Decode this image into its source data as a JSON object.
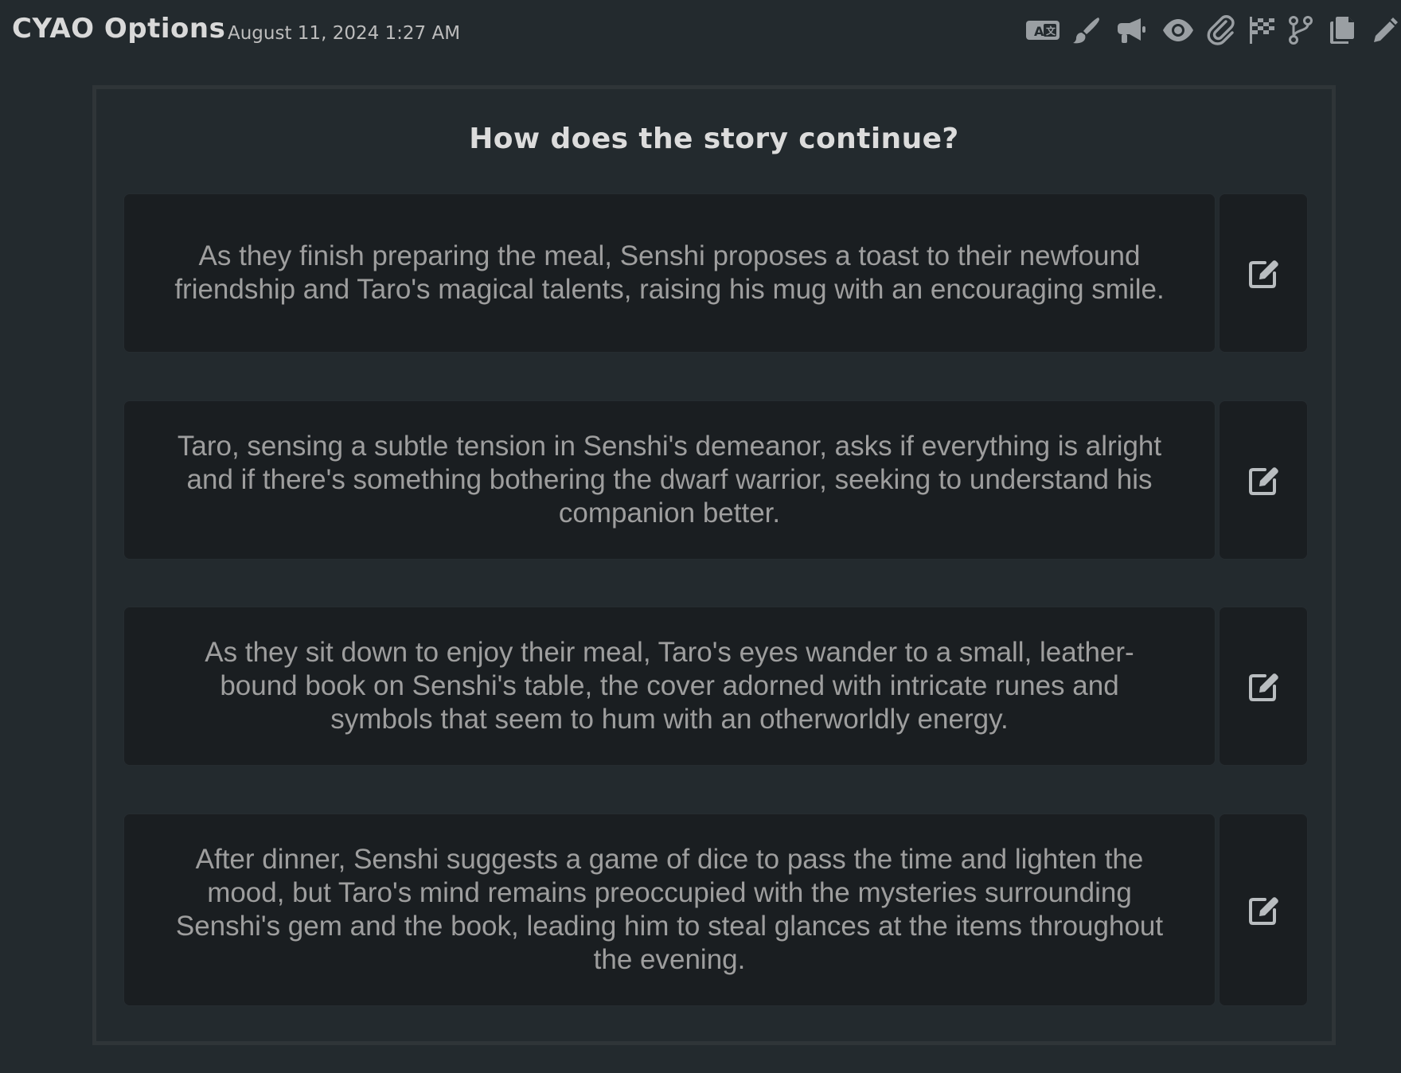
{
  "header": {
    "title": "CYAO Options",
    "timestamp": "August 11, 2024 1:27 AM",
    "toolbar_icons": [
      "translate-icon",
      "brush-icon",
      "megaphone-icon",
      "eye-icon",
      "paperclip-icon",
      "checkered-flag-icon",
      "branch-icon",
      "copy-icon",
      "pencil-icon"
    ]
  },
  "panel": {
    "question": "How does the story continue?",
    "options": [
      {
        "text": "As they finish preparing the meal, Senshi proposes a toast to their newfound friendship and Taro's magical talents, raising his mug with an encouraging smile.",
        "action_icon": "edit-icon"
      },
      {
        "text": "Taro, sensing a subtle tension in Senshi's demeanor, asks if everything is alright and if there's something bothering the dwarf warrior, seeking to understand his companion better.",
        "action_icon": "edit-icon"
      },
      {
        "text": "As they sit down to enjoy their meal, Taro's eyes wander to a small, leather-bound book on Senshi's table, the cover adorned with intricate runes and symbols that seem to hum with an otherworldly energy.",
        "action_icon": "edit-icon"
      },
      {
        "text": "After dinner, Senshi suggests a game of dice to pass the time and lighten the mood, but Taro's mind remains preoccupied with the mysteries surrounding Senshi's gem and the book, leading him to steal glances at the items throughout the evening.",
        "action_icon": "edit-icon"
      }
    ]
  },
  "colors": {
    "background": "#232a2e",
    "card": "#1a1e21",
    "panel_border": "#2f3538",
    "icon": "#9a9fa3",
    "option_text": "#9e9e9e"
  }
}
